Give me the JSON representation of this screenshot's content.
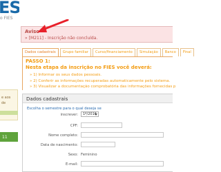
{
  "header": {
    "logo_text": "ES",
    "logo_subtext": "o FIES"
  },
  "left_panel": {
    "text": "e aos\nde"
  },
  "left_bottom": {
    "label": "11"
  },
  "alert": {
    "title": "Aviso",
    "bullet": "»",
    "message": "[M211] - Inscrição não concluída."
  },
  "tabs": [
    {
      "label": "Dados cadastrais"
    },
    {
      "label": "Grupo familiar"
    },
    {
      "label": "Curso/financiamento"
    },
    {
      "label": "Simulação"
    },
    {
      "label": "Banco"
    },
    {
      "label": "Final"
    }
  ],
  "passo": {
    "title": "PASSO 1:",
    "subtitle": "Nesta etapa da inscrição no FIES você deverá:",
    "steps": [
      "» 1) Informar os seus dados pessoais.",
      "» 2) Conferir as informações recuperadas automaticamente pelo sistema.",
      "» 3) Visualizar a documentação comprobatória das informações fornecidas p"
    ]
  },
  "dados": {
    "title": "Dados cadastrais",
    "instruction": "Escolha o semestre para o qual deseja se",
    "fields": {
      "inscrever_label": "inscrever:",
      "inscrever_value": "1º/2016",
      "cpf_label": "CPF:",
      "nome_label": "Nome completo:",
      "nascimento_label": "Data de nascimento:",
      "sexo_label": "Sexo:",
      "sexo_value": "Feminino",
      "email_label": "E-mail:"
    }
  },
  "colors": {
    "alert_text": "#b94a48",
    "alert_bg": "#fbe3e4",
    "tab_orange": "#f39c12",
    "link_blue": "#2b6cb0",
    "arrow_red": "#e8202a"
  }
}
